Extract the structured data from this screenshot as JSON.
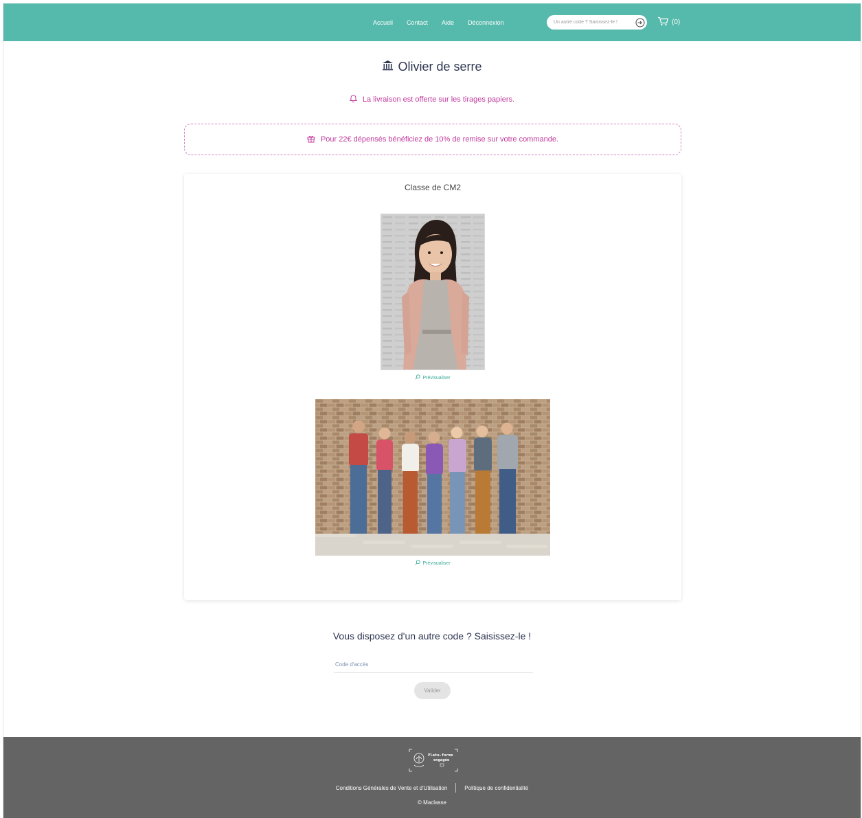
{
  "header": {
    "nav": [
      "Accueil",
      "Contact",
      "Aide",
      "Déconnexion"
    ],
    "code_placeholder": "Un autre code ? Saisissez-le !",
    "cart_count": "(0)",
    "colors": {
      "primary": "#55b9ab"
    }
  },
  "school": {
    "name": "Olivier de serre",
    "icon": "bank-icon"
  },
  "delivery_notice": "La livraison est offerte sur les tirages papiers.",
  "promo": "Pour 22€ dépensés bénéficiez de 10% de remise sur votre commande.",
  "gallery": {
    "title": "Classe de CM2",
    "preview_label": "Prévisualiser"
  },
  "other_code": {
    "title": "Vous disposez d'un autre code ? Saisissez-le !",
    "placeholder": "Code d'accès",
    "button": "Valider"
  },
  "footer": {
    "links": [
      "Conditions Générales de Vente et d'Utilisation",
      "Politique de confidentialité"
    ],
    "copyright": "© Maclasse",
    "logo_text": [
      "Plate-forme",
      "engagée"
    ]
  }
}
